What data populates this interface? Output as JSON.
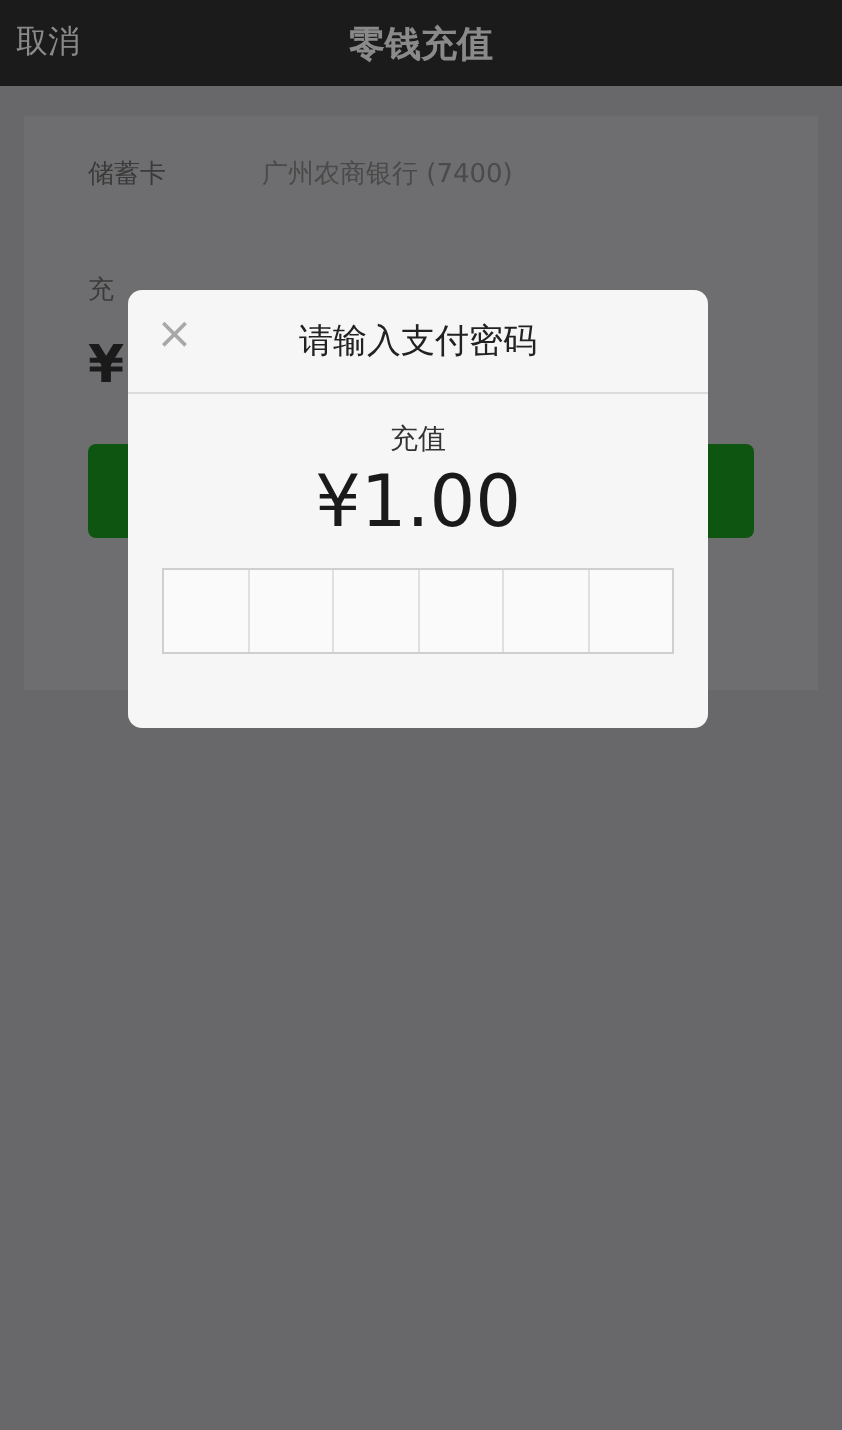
{
  "nav": {
    "cancel": "取消",
    "title": "零钱充值"
  },
  "form": {
    "card_label": "储蓄卡",
    "card_value": "广州农商银行 (7400)",
    "amount_label": "充",
    "amount_prefix": "¥"
  },
  "dialog": {
    "close": "×",
    "title": "请输入支付密码",
    "caption": "充值",
    "amount": "¥1.00",
    "digits": [
      {
        "filled": false
      },
      {
        "filled": false
      },
      {
        "filled": false
      },
      {
        "filled": false
      },
      {
        "filled": false
      },
      {
        "filled": false
      }
    ]
  }
}
